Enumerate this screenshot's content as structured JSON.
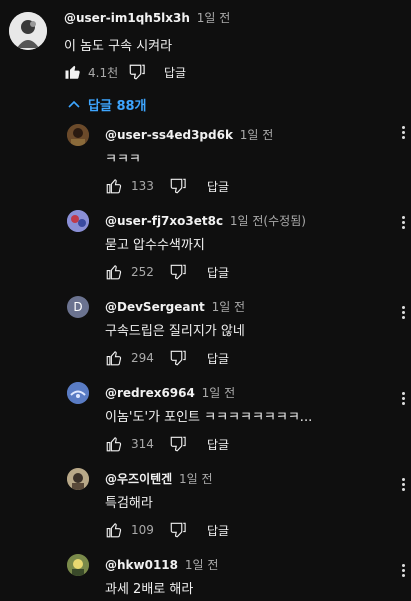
{
  "main_comment": {
    "author": "@user-im1qh5lx3h",
    "time": "1일 전",
    "text": "이 놈도 구속 시켜라",
    "likes": "4.1천",
    "reply_label": "답글",
    "icons": {
      "like": "thumbs-up-icon",
      "dislike": "thumbs-down-icon"
    }
  },
  "replies_toggle": {
    "label": "답글 88개",
    "icon": "chevron-up-icon"
  },
  "replies": [
    {
      "author": "@user-ss4ed3pd6k",
      "time": "1일 전",
      "text": "ㅋㅋㅋ",
      "likes": "133",
      "reply_label": "답글"
    },
    {
      "author": "@user-fj7xo3et8c",
      "time": "1일 전(수정됨)",
      "text": "묻고 압수수색까지",
      "likes": "252",
      "reply_label": "답글"
    },
    {
      "author": "@DevSergeant",
      "time": "1일 전",
      "text": "구속드립은 질리지가 않네",
      "likes": "294",
      "reply_label": "답글",
      "avatar_letter": "D"
    },
    {
      "author": "@redrex6964",
      "time": "1일 전",
      "text": "이놈'도'가 포인트 ㅋㅋㅋㅋㅋㅋㅋㅋ...",
      "likes": "314",
      "reply_label": "답글"
    },
    {
      "author": "@우즈이텐겐",
      "time": "1일 전",
      "text": "특검해라",
      "likes": "109",
      "reply_label": "답글"
    },
    {
      "author": "@hkw0118",
      "time": "1일 전",
      "text": "과세 2배로 해라"
    }
  ],
  "colors": {
    "background": "#0f0f0f",
    "link": "#3ea6ff",
    "secondary_text": "#aaaaaa"
  }
}
